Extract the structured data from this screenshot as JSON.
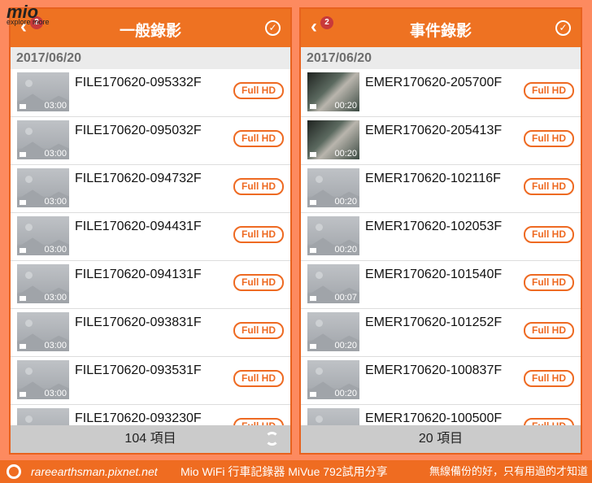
{
  "logo": {
    "brand": "mio",
    "tagline": "explore more"
  },
  "left": {
    "title": "一般錄影",
    "badge": "2",
    "date": "2017/06/20",
    "footer": "104 項目",
    "items": [
      {
        "name": "FILE170620-095332F",
        "duration": "03:00",
        "badge": "Full HD"
      },
      {
        "name": "FILE170620-095032F",
        "duration": "03:00",
        "badge": "Full HD"
      },
      {
        "name": "FILE170620-094732F",
        "duration": "03:00",
        "badge": "Full HD"
      },
      {
        "name": "FILE170620-094431F",
        "duration": "03:00",
        "badge": "Full HD"
      },
      {
        "name": "FILE170620-094131F",
        "duration": "03:00",
        "badge": "Full HD"
      },
      {
        "name": "FILE170620-093831F",
        "duration": "03:00",
        "badge": "Full HD"
      },
      {
        "name": "FILE170620-093531F",
        "duration": "03:00",
        "badge": "Full HD"
      },
      {
        "name": "FILE170620-093230F",
        "duration": "",
        "badge": "Full HD"
      }
    ]
  },
  "right": {
    "title": "事件錄影",
    "badge": "2",
    "date": "2017/06/20",
    "footer": "20 項目",
    "items": [
      {
        "name": "EMER170620-205700F",
        "duration": "00:20",
        "badge": "Full HD",
        "video": true
      },
      {
        "name": "EMER170620-205413F",
        "duration": "00:20",
        "badge": "Full HD",
        "video": true
      },
      {
        "name": "EMER170620-102116F",
        "duration": "00:20",
        "badge": "Full HD"
      },
      {
        "name": "EMER170620-102053F",
        "duration": "00:20",
        "badge": "Full HD"
      },
      {
        "name": "EMER170620-101540F",
        "duration": "00:07",
        "badge": "Full HD"
      },
      {
        "name": "EMER170620-101252F",
        "duration": "00:20",
        "badge": "Full HD"
      },
      {
        "name": "EMER170620-100837F",
        "duration": "00:20",
        "badge": "Full HD"
      },
      {
        "name": "EMER170620-100500F",
        "duration": "",
        "badge": "Full HD"
      }
    ]
  },
  "banner": {
    "site": "rareearthsman.pixnet.net",
    "title": "Mio WiFi 行車記錄器 MiVue 792試用分享",
    "slogan": "無線備份的好，只有用過的才知道"
  }
}
